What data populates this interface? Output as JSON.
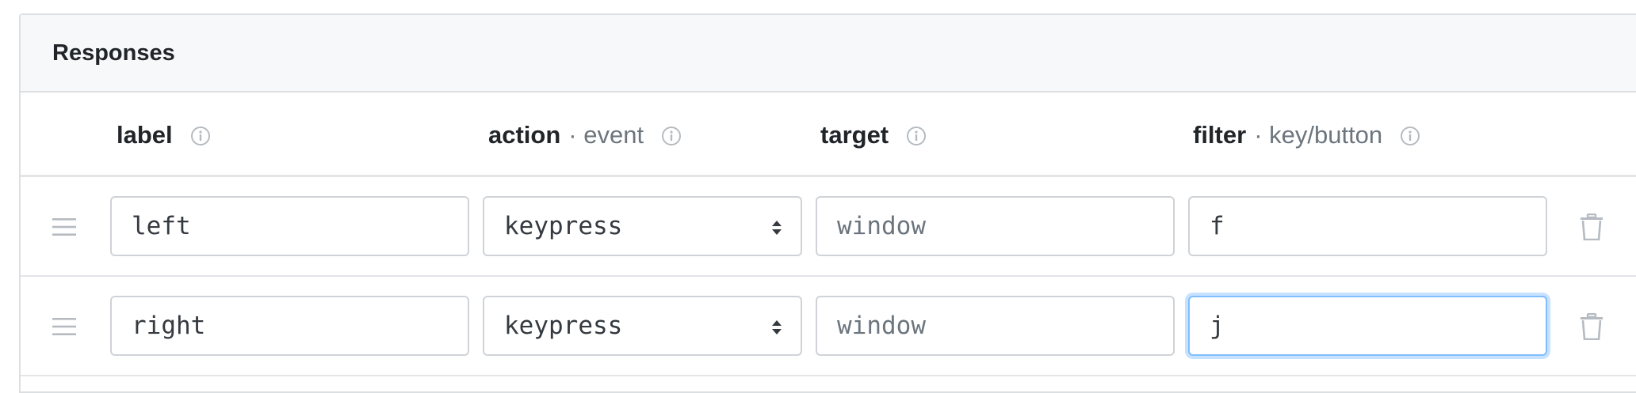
{
  "panel": {
    "title": "Responses"
  },
  "columns": [
    {
      "main": "label",
      "sub": "",
      "icon": "info-icon"
    },
    {
      "main": "action",
      "sub": "· event",
      "icon": "info-icon"
    },
    {
      "main": "target",
      "sub": "",
      "icon": "info-icon"
    },
    {
      "main": "filter",
      "sub": "· key/button",
      "icon": "info-icon"
    }
  ],
  "rows": [
    {
      "label": "left",
      "action": "keypress",
      "target_placeholder": "window",
      "filter": "f"
    },
    {
      "label": "right",
      "action": "keypress",
      "target_placeholder": "window",
      "filter": "j"
    }
  ],
  "icons": {
    "drag": "drag-handle-icon",
    "delete": "trash-icon",
    "select": "select-caret-icon"
  },
  "colors": {
    "focus_border": "#80bdff",
    "header_bg": "#f7f8f9",
    "border": "#dcdfe2"
  }
}
